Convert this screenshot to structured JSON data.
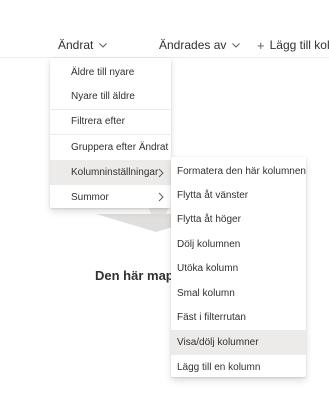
{
  "header": {
    "columns": [
      {
        "label": "Ändrat",
        "icon": "chevron-down-icon"
      },
      {
        "label": "Ändrades av",
        "icon": "chevron-down-icon"
      },
      {
        "label": "Lägg till kolumn",
        "icon": "plus-icon",
        "plus": "+"
      }
    ]
  },
  "empty_state": {
    "title": "Den här mapp"
  },
  "menu": {
    "items": [
      {
        "label": "Äldre till nyare"
      },
      {
        "label": "Nyare till äldre"
      },
      {
        "label": "Filtrera efter"
      },
      {
        "label": "Gruppera efter Ändrat"
      },
      {
        "label": "Kolumninställningar",
        "submenu": true,
        "active": true
      },
      {
        "label": "Summor",
        "submenu": true
      }
    ]
  },
  "submenu": {
    "items": [
      {
        "label": "Formatera den här kolumnen"
      },
      {
        "label": "Flytta åt vänster"
      },
      {
        "label": "Flytta åt höger"
      },
      {
        "label": "Dölj kolumnen"
      },
      {
        "label": "Utöka kolumn"
      },
      {
        "label": "Smal kolumn"
      },
      {
        "label": "Fäst i filterrutan"
      },
      {
        "label": "Visa/dölj kolumner",
        "active": true
      },
      {
        "label": "Lägg till en kolumn"
      }
    ]
  },
  "colors": {
    "text": "#323130",
    "hover": "#edebe9",
    "divider": "#edebe9",
    "illustration": "#e1dfdd"
  }
}
